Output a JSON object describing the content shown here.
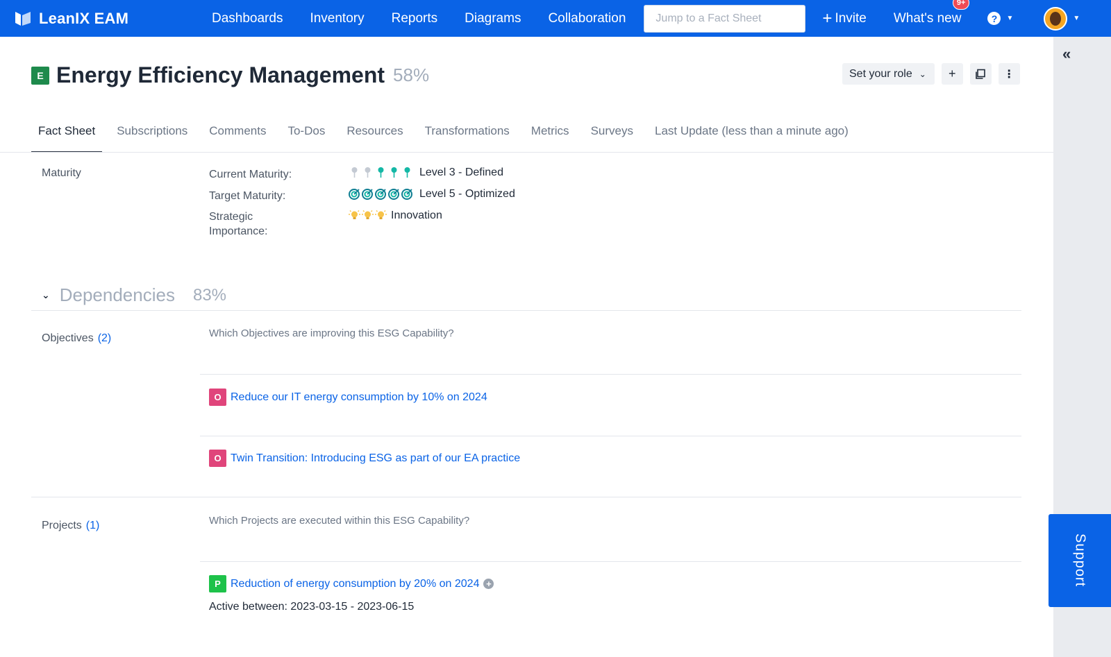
{
  "app": {
    "brand": "LeanIX EAM"
  },
  "nav": {
    "items": [
      "Dashboards",
      "Inventory",
      "Reports",
      "Diagrams",
      "Collaboration"
    ],
    "search_placeholder": "Jump to a Fact Sheet",
    "invite_label": "Invite",
    "whats_new_label": "What's new",
    "whats_new_badge": "9+",
    "help_label": "?"
  },
  "colors": {
    "primary": "#0a63e6",
    "objective": "#e0457b",
    "project": "#1ec24a",
    "capability": "#1e8a4c",
    "maturity_pin": "#14b8a6",
    "importance_bulb": "#f7c348"
  },
  "header": {
    "type_letter": "E",
    "title": "Energy Efficiency Management",
    "completion": "58%",
    "role_button": "Set your role"
  },
  "tabs": [
    {
      "label": "Fact Sheet",
      "active": true
    },
    {
      "label": "Subscriptions"
    },
    {
      "label": "Comments"
    },
    {
      "label": "To-Dos"
    },
    {
      "label": "Resources"
    },
    {
      "label": "Transformations"
    },
    {
      "label": "Metrics"
    },
    {
      "label": "Surveys"
    },
    {
      "label": "Last Update (less than a minute ago)"
    }
  ],
  "maturity": {
    "section_label": "Maturity",
    "current_label": "Current Maturity:",
    "current_value": "Level 3 - Defined",
    "current_level": 3,
    "current_max": 5,
    "target_label": "Target Maturity:",
    "target_value": "Level 5 - Optimized",
    "target_level": 5,
    "importance_label_line1": "Strategic",
    "importance_label_line2": "Importance:",
    "importance_value": "Innovation",
    "importance_level": 3
  },
  "dependencies": {
    "title": "Dependencies",
    "completion": "83%",
    "objectives": {
      "label": "Objectives",
      "count": "(2)",
      "question": "Which Objectives are improving this ESG Capability?",
      "items": [
        {
          "letter": "O",
          "name": "Reduce our IT energy consumption by 10% on 2024"
        },
        {
          "letter": "O",
          "name": "Twin Transition: Introducing ESG as part of our EA practice"
        }
      ]
    },
    "projects": {
      "label": "Projects",
      "count": "(1)",
      "question": "Which Projects are executed within this ESG Capability?",
      "items": [
        {
          "letter": "P",
          "name": "Reduction of energy consumption by 20% on 2024",
          "active_between": "Active between: 2023-03-15 - 2023-06-15"
        }
      ]
    }
  },
  "support_label": "Support"
}
